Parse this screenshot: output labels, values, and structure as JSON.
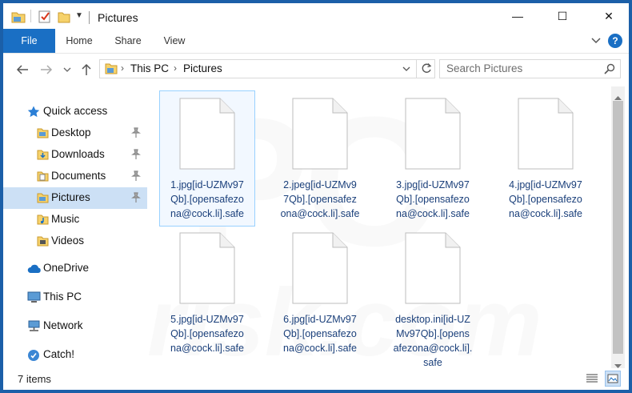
{
  "window": {
    "title": "Pictures",
    "controls": {
      "minimize": "—",
      "maximize": "☐",
      "close": "✕"
    }
  },
  "ribbon": {
    "tabs": [
      "File",
      "Home",
      "Share",
      "View"
    ],
    "help": "?"
  },
  "address": {
    "segments": [
      "This PC",
      "Pictures"
    ],
    "search_placeholder": "Search Pictures"
  },
  "sidebar": {
    "items": [
      {
        "label": "Quick access",
        "icon": "star-icon"
      },
      {
        "label": "Desktop",
        "icon": "folder-icon",
        "pinned": true
      },
      {
        "label": "Downloads",
        "icon": "download-folder-icon",
        "pinned": true
      },
      {
        "label": "Documents",
        "icon": "documents-folder-icon",
        "pinned": true
      },
      {
        "label": "Pictures",
        "icon": "pictures-folder-icon",
        "pinned": true,
        "selected": true
      },
      {
        "label": "Music",
        "icon": "music-folder-icon"
      },
      {
        "label": "Videos",
        "icon": "videos-folder-icon"
      },
      {
        "label": "OneDrive",
        "icon": "cloud-icon"
      },
      {
        "label": "This PC",
        "icon": "computer-icon"
      },
      {
        "label": "Network",
        "icon": "network-icon"
      },
      {
        "label": "Catch!",
        "icon": "catch-icon"
      }
    ]
  },
  "files": [
    {
      "lines": [
        "1.jpg[id-UZMv97",
        "Qb].[opensafezo",
        "na@cock.li].safe"
      ]
    },
    {
      "lines": [
        "2.jpeg[id-UZMv9",
        "7Qb].[opensafez",
        "ona@cock.li].safe"
      ]
    },
    {
      "lines": [
        "3.jpg[id-UZMv97",
        "Qb].[opensafezo",
        "na@cock.li].safe"
      ]
    },
    {
      "lines": [
        "4.jpg[id-UZMv97",
        "Qb].[opensafezo",
        "na@cock.li].safe"
      ]
    },
    {
      "lines": [
        "5.jpg[id-UZMv97",
        "Qb].[opensafezo",
        "na@cock.li].safe"
      ]
    },
    {
      "lines": [
        "6.jpg[id-UZMv97",
        "Qb].[opensafezo",
        "na@cock.li].safe"
      ]
    },
    {
      "lines": [
        "desktop.ini[id-UZ",
        "Mv97Qb].[opens",
        "afezona@cock.li].",
        "safe"
      ]
    }
  ],
  "status": {
    "item_count": "7 items"
  },
  "colors": {
    "accent": "#1a6fc4",
    "frame": "#1b5fa8",
    "selection": "#cce0f5"
  }
}
